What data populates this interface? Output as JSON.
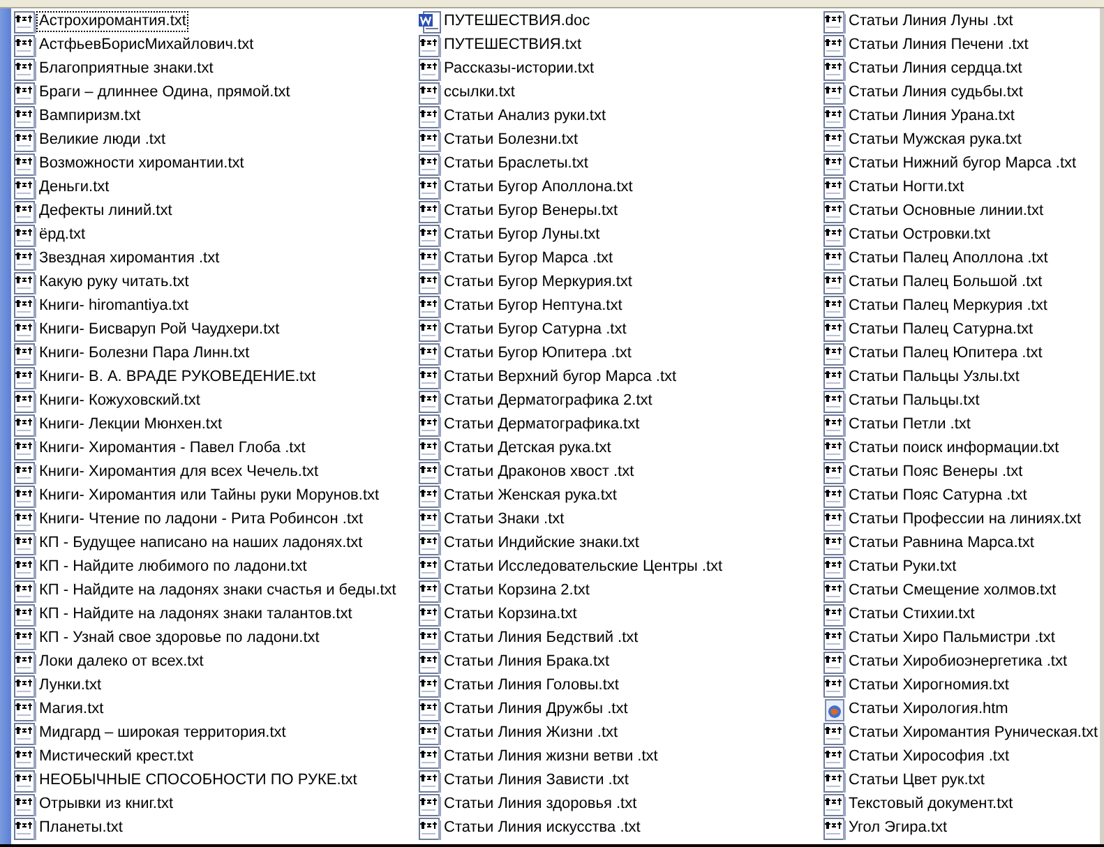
{
  "files": [
    {
      "name": "Астрохиромантия.txt",
      "kind": "txt",
      "focused": true
    },
    {
      "name": "АстфьевБорисМихайлович.txt",
      "kind": "txt",
      "focused": false
    },
    {
      "name": "Благоприятные знаки.txt",
      "kind": "txt",
      "focused": false
    },
    {
      "name": "Браги – длиннее Одина, прямой.txt",
      "kind": "txt",
      "focused": false
    },
    {
      "name": "Вампиризм.txt",
      "kind": "txt",
      "focused": false
    },
    {
      "name": "Великие люди .txt",
      "kind": "txt",
      "focused": false
    },
    {
      "name": "Возможности хиромантии.txt",
      "kind": "txt",
      "focused": false
    },
    {
      "name": "Деньги.txt",
      "kind": "txt",
      "focused": false
    },
    {
      "name": "Дефекты линий.txt",
      "kind": "txt",
      "focused": false
    },
    {
      "name": "ёрд.txt",
      "kind": "txt",
      "focused": false
    },
    {
      "name": "Звездная хиромантия .txt",
      "kind": "txt",
      "focused": false
    },
    {
      "name": "Какую руку читать.txt",
      "kind": "txt",
      "focused": false
    },
    {
      "name": "Книги- hiromantiya.txt",
      "kind": "txt",
      "focused": false
    },
    {
      "name": "Книги- Бисваруп Рой Чаудхери.txt",
      "kind": "txt",
      "focused": false
    },
    {
      "name": "Книги- Болезни Пара Линн.txt",
      "kind": "txt",
      "focused": false
    },
    {
      "name": "Книги- В. А. ВРАДЕ РУКОВЕДЕНИЕ.txt",
      "kind": "txt",
      "focused": false
    },
    {
      "name": "Книги- Кожуховский.txt",
      "kind": "txt",
      "focused": false
    },
    {
      "name": "Книги- Лекции Мюнхен.txt",
      "kind": "txt",
      "focused": false
    },
    {
      "name": "Книги- Хиромантия - Павел Глоба .txt",
      "kind": "txt",
      "focused": false
    },
    {
      "name": "Книги- Хиромантия для всех Чечель.txt",
      "kind": "txt",
      "focused": false
    },
    {
      "name": "Книги- Хиромантия или Тайны руки Морунов.txt",
      "kind": "txt",
      "focused": false
    },
    {
      "name": "Книги- Чтение по ладони - Рита Робинсон .txt",
      "kind": "txt",
      "focused": false
    },
    {
      "name": "КП - Будущее написано на наших ладонях.txt",
      "kind": "txt",
      "focused": false
    },
    {
      "name": "КП - Найдите любимого по ладони.txt",
      "kind": "txt",
      "focused": false
    },
    {
      "name": "КП - Найдите на ладонях знаки счастья и беды.txt",
      "kind": "txt",
      "focused": false
    },
    {
      "name": "КП - Найдите на ладонях знаки талантов.txt",
      "kind": "txt",
      "focused": false
    },
    {
      "name": "КП - Узнай свое здоровье по ладони.txt",
      "kind": "txt",
      "focused": false
    },
    {
      "name": "Локи далеко от всех.txt",
      "kind": "txt",
      "focused": false
    },
    {
      "name": "Лунки.txt",
      "kind": "txt",
      "focused": false
    },
    {
      "name": "Магия.txt",
      "kind": "txt",
      "focused": false
    },
    {
      "name": "Мидгард – широкая территория.txt",
      "kind": "txt",
      "focused": false
    },
    {
      "name": "Мистический крест.txt",
      "kind": "txt",
      "focused": false
    },
    {
      "name": "НЕОБЫЧНЫЕ СПОСОБНОСТИ ПО РУКЕ.txt",
      "kind": "txt",
      "focused": false
    },
    {
      "name": "Отрывки из книг.txt",
      "kind": "txt",
      "focused": false
    },
    {
      "name": "Планеты.txt",
      "kind": "txt",
      "focused": false
    },
    {
      "name": "ПУТЕШЕСТВИЯ.doc",
      "kind": "doc",
      "focused": false
    },
    {
      "name": "ПУТЕШЕСТВИЯ.txt",
      "kind": "txt",
      "focused": false
    },
    {
      "name": "Рассказы-истории.txt",
      "kind": "txt",
      "focused": false
    },
    {
      "name": "ссылки.txt",
      "kind": "txt",
      "focused": false
    },
    {
      "name": "Статьи Анализ руки.txt",
      "kind": "txt",
      "focused": false
    },
    {
      "name": "Статьи Болезни.txt",
      "kind": "txt",
      "focused": false
    },
    {
      "name": "Статьи Браслеты.txt",
      "kind": "txt",
      "focused": false
    },
    {
      "name": "Статьи Бугор Аполлона.txt",
      "kind": "txt",
      "focused": false
    },
    {
      "name": "Статьи Бугор Венеры.txt",
      "kind": "txt",
      "focused": false
    },
    {
      "name": "Статьи Бугор Луны.txt",
      "kind": "txt",
      "focused": false
    },
    {
      "name": "Статьи Бугор Марса .txt",
      "kind": "txt",
      "focused": false
    },
    {
      "name": "Статьи Бугор Меркурия.txt",
      "kind": "txt",
      "focused": false
    },
    {
      "name": "Статьи Бугор Нептуна.txt",
      "kind": "txt",
      "focused": false
    },
    {
      "name": "Статьи Бугор Сатурна .txt",
      "kind": "txt",
      "focused": false
    },
    {
      "name": "Статьи Бугор Юпитера .txt",
      "kind": "txt",
      "focused": false
    },
    {
      "name": "Статьи Верхний бугор Марса .txt",
      "kind": "txt",
      "focused": false
    },
    {
      "name": "Статьи Дерматографика 2.txt",
      "kind": "txt",
      "focused": false
    },
    {
      "name": "Статьи Дерматографика.txt",
      "kind": "txt",
      "focused": false
    },
    {
      "name": "Статьи Детская рука.txt",
      "kind": "txt",
      "focused": false
    },
    {
      "name": "Статьи Драконов хвост .txt",
      "kind": "txt",
      "focused": false
    },
    {
      "name": "Статьи Женская рука.txt",
      "kind": "txt",
      "focused": false
    },
    {
      "name": "Статьи Знаки .txt",
      "kind": "txt",
      "focused": false
    },
    {
      "name": "Статьи Индийские знаки.txt",
      "kind": "txt",
      "focused": false
    },
    {
      "name": "Статьи Исследовательские Центры .txt",
      "kind": "txt",
      "focused": false
    },
    {
      "name": "Статьи Корзина 2.txt",
      "kind": "txt",
      "focused": false
    },
    {
      "name": "Статьи Корзина.txt",
      "kind": "txt",
      "focused": false
    },
    {
      "name": "Статьи Линия Бедствий .txt",
      "kind": "txt",
      "focused": false
    },
    {
      "name": "Статьи Линия Брака.txt",
      "kind": "txt",
      "focused": false
    },
    {
      "name": "Статьи Линия Головы.txt",
      "kind": "txt",
      "focused": false
    },
    {
      "name": "Статьи Линия Дружбы .txt",
      "kind": "txt",
      "focused": false
    },
    {
      "name": "Статьи Линия Жизни .txt",
      "kind": "txt",
      "focused": false
    },
    {
      "name": "Статьи Линия жизни ветви .txt",
      "kind": "txt",
      "focused": false
    },
    {
      "name": "Статьи Линия Зависти .txt",
      "kind": "txt",
      "focused": false
    },
    {
      "name": "Статьи Линия здоровья .txt",
      "kind": "txt",
      "focused": false
    },
    {
      "name": "Статьи Линия искусства .txt",
      "kind": "txt",
      "focused": false
    },
    {
      "name": "Статьи Линия Луны .txt",
      "kind": "txt",
      "focused": false
    },
    {
      "name": "Статьи Линия Печени .txt",
      "kind": "txt",
      "focused": false
    },
    {
      "name": "Статьи Линия сердца.txt",
      "kind": "txt",
      "focused": false
    },
    {
      "name": "Статьи Линия судьбы.txt",
      "kind": "txt",
      "focused": false
    },
    {
      "name": "Статьи Линия Урана.txt",
      "kind": "txt",
      "focused": false
    },
    {
      "name": "Статьи Мужская рука.txt",
      "kind": "txt",
      "focused": false
    },
    {
      "name": "Статьи Нижний бугор Марса .txt",
      "kind": "txt",
      "focused": false
    },
    {
      "name": "Статьи Ногти.txt",
      "kind": "txt",
      "focused": false
    },
    {
      "name": "Статьи Основные линии.txt",
      "kind": "txt",
      "focused": false
    },
    {
      "name": "Статьи Островки.txt",
      "kind": "txt",
      "focused": false
    },
    {
      "name": "Статьи Палец Аполлона .txt",
      "kind": "txt",
      "focused": false
    },
    {
      "name": "Статьи Палец Большой .txt",
      "kind": "txt",
      "focused": false
    },
    {
      "name": "Статьи Палец Меркурия .txt",
      "kind": "txt",
      "focused": false
    },
    {
      "name": "Статьи Палец Сатурна.txt",
      "kind": "txt",
      "focused": false
    },
    {
      "name": "Статьи Палец Юпитера .txt",
      "kind": "txt",
      "focused": false
    },
    {
      "name": "Статьи Пальцы Узлы.txt",
      "kind": "txt",
      "focused": false
    },
    {
      "name": "Статьи Пальцы.txt",
      "kind": "txt",
      "focused": false
    },
    {
      "name": "Статьи Петли .txt",
      "kind": "txt",
      "focused": false
    },
    {
      "name": "Статьи поиск информации.txt",
      "kind": "txt",
      "focused": false
    },
    {
      "name": "Статьи Пояс Венеры .txt",
      "kind": "txt",
      "focused": false
    },
    {
      "name": "Статьи Пояс Сатурна .txt",
      "kind": "txt",
      "focused": false
    },
    {
      "name": "Статьи Профессии на линиях.txt",
      "kind": "txt",
      "focused": false
    },
    {
      "name": "Статьи Равнина Марса.txt",
      "kind": "txt",
      "focused": false
    },
    {
      "name": "Статьи Руки.txt",
      "kind": "txt",
      "focused": false
    },
    {
      "name": "Статьи Смещение холмов.txt",
      "kind": "txt",
      "focused": false
    },
    {
      "name": "Статьи Стихии.txt",
      "kind": "txt",
      "focused": false
    },
    {
      "name": "Статьи Хиро Пальмистри  .txt",
      "kind": "txt",
      "focused": false
    },
    {
      "name": "Статьи Хиробиоэнергетика .txt",
      "kind": "txt",
      "focused": false
    },
    {
      "name": "Статьи Хирогномия.txt",
      "kind": "txt",
      "focused": false
    },
    {
      "name": "Статьи Хирология.htm",
      "kind": "htm",
      "focused": false
    },
    {
      "name": "Статьи Хиромантия Руническая.txt",
      "kind": "txt",
      "focused": false
    },
    {
      "name": "Статьи Хирософия .txt",
      "kind": "txt",
      "focused": false
    },
    {
      "name": "Статьи Цвет рук.txt",
      "kind": "txt",
      "focused": false
    },
    {
      "name": "Текстовый документ.txt",
      "kind": "txt",
      "focused": false
    },
    {
      "name": "Угол Эгира.txt",
      "kind": "txt",
      "focused": false
    }
  ]
}
